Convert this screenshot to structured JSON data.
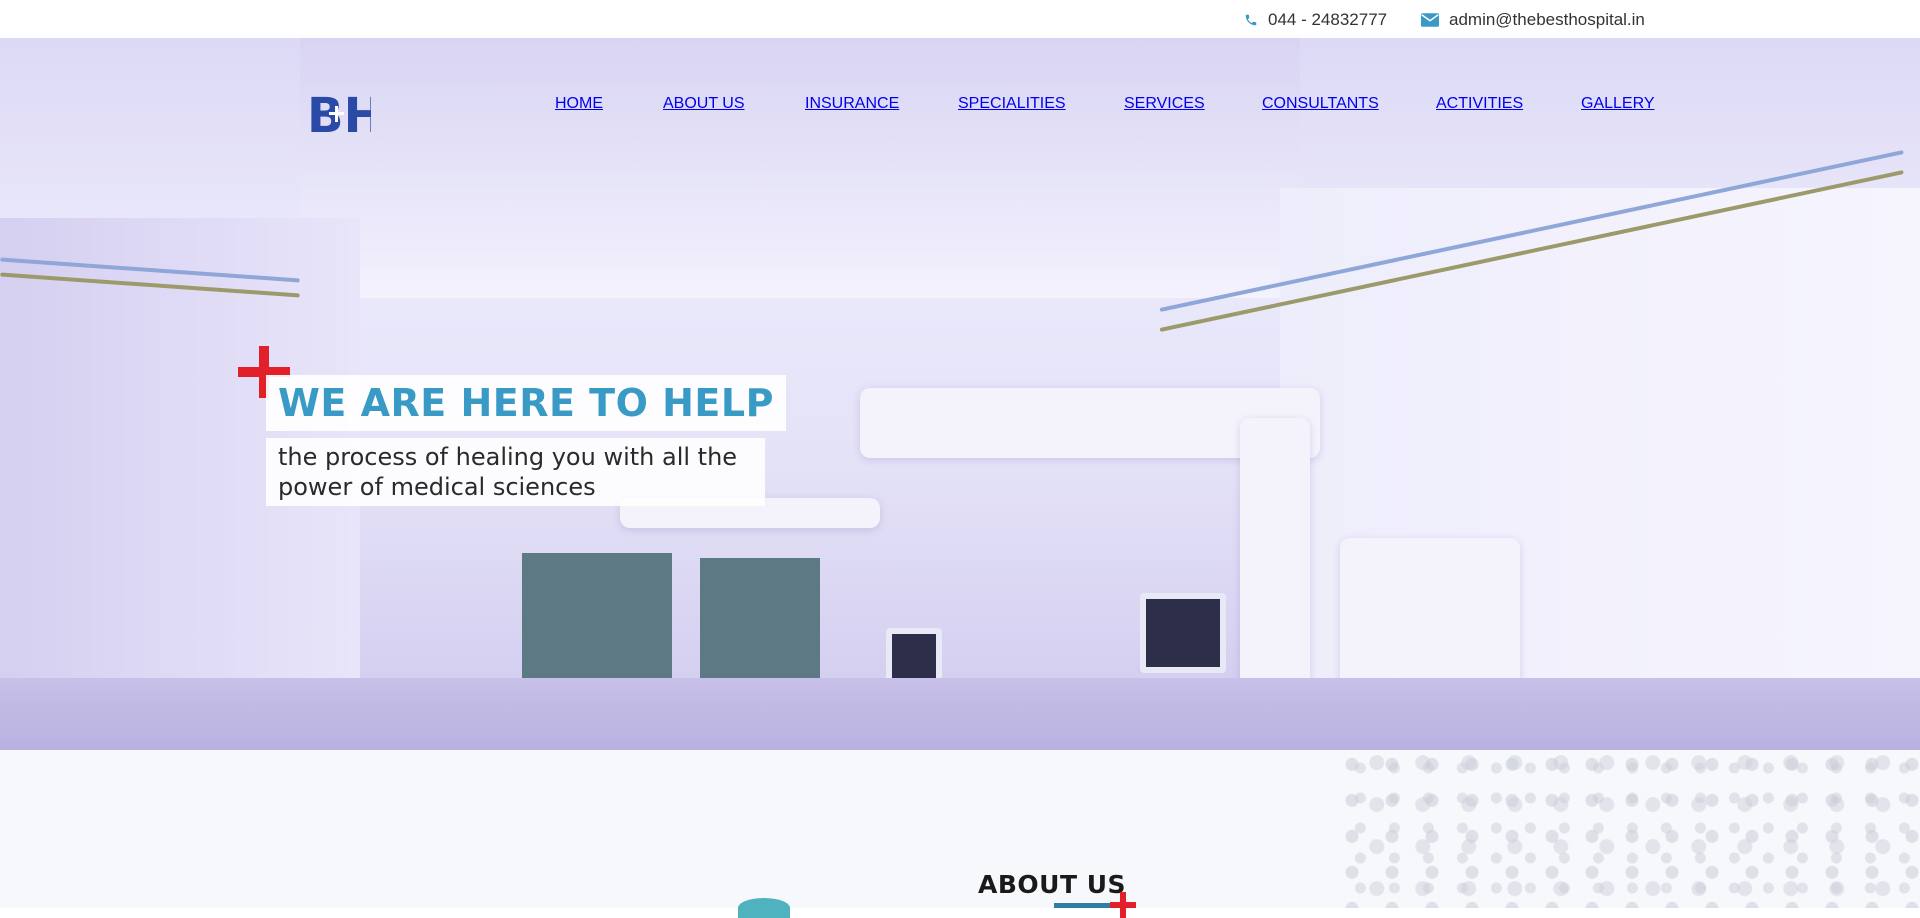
{
  "topbar": {
    "phone": "044 - 24832777",
    "email": "admin@thebesthospital.in",
    "phone_icon": "phone-icon",
    "email_icon": "envelope-icon",
    "icon_color": "#3a9ac6"
  },
  "logo": {
    "text": "BH",
    "color": "#2a4aa8"
  },
  "nav": {
    "items": [
      {
        "label": "HOME",
        "active": true
      },
      {
        "label": "ABOUT US"
      },
      {
        "label": "INSURANCE"
      },
      {
        "label": "SPECIALITIES"
      },
      {
        "label": "SERVICES"
      },
      {
        "label": "CONSULTANTS"
      },
      {
        "label": "ACTIVITIES"
      },
      {
        "label": "GALLERY"
      }
    ],
    "active_underline_color": "#3a9ac6"
  },
  "hero": {
    "headline": "WE ARE HERE TO HELP",
    "subtitle_line1": "the process of healing you with all the",
    "subtitle_line2": "power of medical sciences",
    "headline_color": "#3a9ac6",
    "cross_color": "#e2202a"
  },
  "about": {
    "title": "ABOUT US"
  }
}
